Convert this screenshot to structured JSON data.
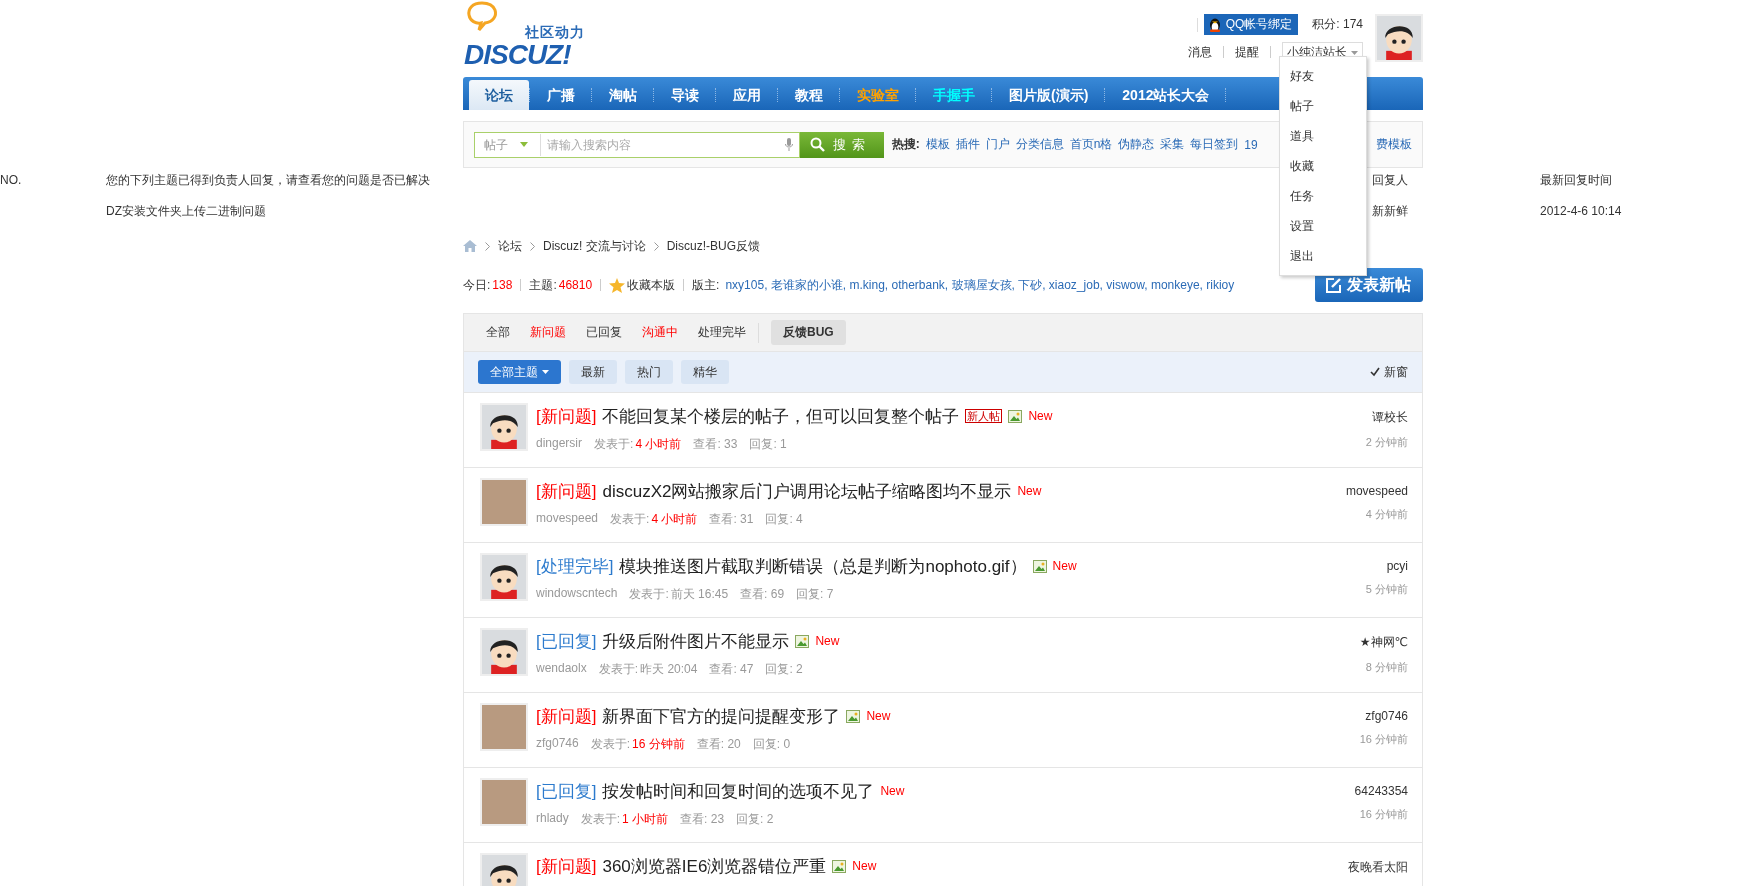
{
  "header": {
    "logo_tagline": "社区动力",
    "logo_text": "DISCUZ!",
    "qq_button": "QQ帐号绑定",
    "points": "积分: 174",
    "links": [
      "消息",
      "提醒"
    ],
    "username": "小纯洁站长"
  },
  "user_menu": [
    "好友",
    "帖子",
    "道具",
    "收藏",
    "任务",
    "设置",
    "退出"
  ],
  "nav": [
    {
      "label": "论坛",
      "selected": true
    },
    {
      "label": "广播",
      "selected": false
    },
    {
      "label": "淘帖",
      "selected": false
    },
    {
      "label": "导读",
      "selected": false
    },
    {
      "label": "应用",
      "selected": false
    },
    {
      "label": "教程",
      "selected": false
    },
    {
      "label": "实验室",
      "selected": false,
      "color": "#ffa200"
    },
    {
      "label": "手握手",
      "selected": false,
      "color": "#00ffff"
    },
    {
      "label": "图片版(演示)",
      "selected": false
    },
    {
      "label": "2012站长大会",
      "selected": false
    }
  ],
  "search": {
    "scope": "帖子",
    "placeholder": "请输入搜索内容",
    "button": "搜 索",
    "hot_label": "热搜:",
    "hot_words": [
      "模板",
      "插件",
      "门户",
      "分类信息",
      "首页n格",
      "伪静态",
      "采集",
      "每日签到",
      "19"
    ],
    "hot_word_tail": "费模板"
  },
  "notice_table": {
    "columns": [
      "NO.",
      "您的下列主题已得到负责人回复，请查看您的问题是否已解决",
      "回复人",
      "最新回复时间"
    ],
    "rows": [
      {
        "subject": "DZ安装文件夹上传二进制问题",
        "replier": "新新鲜",
        "time": "2012-4-6 10:14"
      }
    ]
  },
  "breadcrumb": [
    "论坛",
    "Discuz! 交流与讨论",
    "Discuz!-BUG反馈"
  ],
  "forum_stats": {
    "today_label": "今日:",
    "today": "138",
    "threads_label": "主题:",
    "threads": "46810",
    "favorite": "收藏本版",
    "moderators_label": "版主:",
    "moderators": "nxy105, 老谁家的小谁, m.king, otherbank, 玻璃屋女孩, 下砂, xiaoz_job, viswow, monkeye, rikioy"
  },
  "new_post_button": "发表新帖",
  "status_filters": [
    {
      "label": "全部",
      "highlight": false
    },
    {
      "label": "新问题",
      "highlight": true
    },
    {
      "label": "已回复",
      "highlight": false
    },
    {
      "label": "沟通中",
      "highlight": true
    },
    {
      "label": "处理完毕",
      "highlight": false
    }
  ],
  "category": {
    "label": "反馈BUG",
    "selected": true
  },
  "type_tabs": [
    {
      "label": "全部主题",
      "selected": true,
      "dropdown": true
    },
    {
      "label": "最新",
      "selected": false,
      "dropdown": false
    },
    {
      "label": "热门",
      "selected": false,
      "dropdown": false
    },
    {
      "label": "精华",
      "selected": false,
      "dropdown": false
    }
  ],
  "new_window": {
    "label": "新窗",
    "checked": true
  },
  "threads": [
    {
      "kind": "cartoon",
      "tag": {
        "text": "[新问题]",
        "color": "#ff0000"
      },
      "title": "不能回复某个楼层的帖子，但可以回复整个帖子",
      "new_user_badge": "新人帖",
      "image": true,
      "new": "New",
      "author": "dingersir",
      "posted_label": "发表于:",
      "posted": "4 小时前",
      "recent": true,
      "views": "查看: 33",
      "replies": "回复: 1",
      "last_poster": "谭校长",
      "last_time": "2 分钟前"
    },
    {
      "kind": "photo",
      "tag": {
        "text": "[新问题]",
        "color": "#ff0000"
      },
      "title": "discuzX2网站搬家后门户调用论坛帖子缩略图均不显示",
      "image": false,
      "new": "New",
      "author": "movespeed",
      "posted_label": "发表于:",
      "posted": "4 小时前",
      "recent": true,
      "views": "查看: 31",
      "replies": "回复: 4",
      "last_poster": "movespeed",
      "last_time": "4 分钟前"
    },
    {
      "kind": "cartoon",
      "tag": {
        "text": "[处理完毕]",
        "color": "#2b7acd"
      },
      "title": "模块推送图片截取判断错误（总是判断为nophoto.gif）",
      "image": true,
      "new": "New",
      "author": "windowscntech",
      "posted_label": "发表于:",
      "posted": "前天 16:45",
      "recent": false,
      "views": "查看: 69",
      "replies": "回复: 7",
      "last_poster": "pcyi",
      "last_time": "5 分钟前"
    },
    {
      "kind": "cartoon",
      "tag": {
        "text": "[已回复]",
        "color": "#2b7acd"
      },
      "title": "升级后附件图片不能显示",
      "image": true,
      "new": "New",
      "author": "wendaolx",
      "posted_label": "发表于:",
      "posted": "昨天 20:04",
      "recent": false,
      "views": "查看: 47",
      "replies": "回复: 2",
      "last_poster": "★神网℃",
      "last_time": "8 分钟前"
    },
    {
      "kind": "photo",
      "tag": {
        "text": "[新问题]",
        "color": "#ff0000"
      },
      "title": "新界面下官方的提问提醒变形了",
      "image": true,
      "new": "New",
      "author": "zfg0746",
      "posted_label": "发表于:",
      "posted": "16 分钟前",
      "recent": true,
      "views": "查看: 20",
      "replies": "回复: 0",
      "last_poster": "zfg0746",
      "last_time": "16 分钟前"
    },
    {
      "kind": "photo",
      "tag": {
        "text": "[已回复]",
        "color": "#2b7acd"
      },
      "title": "按发帖时间和回复时间的选项不见了",
      "image": false,
      "new": "New",
      "author": "rhlady",
      "posted_label": "发表于:",
      "posted": "1 小时前",
      "recent": true,
      "views": "查看: 23",
      "replies": "回复: 2",
      "last_poster": "64243354",
      "last_time": "16 分钟前"
    },
    {
      "kind": "cartoon",
      "tag": {
        "text": "[新问题]",
        "color": "#ff0000"
      },
      "title": "360浏览器IE6浏览器错位严重",
      "image": true,
      "new": "New",
      "last_poster": "夜晚看太阳"
    }
  ]
}
